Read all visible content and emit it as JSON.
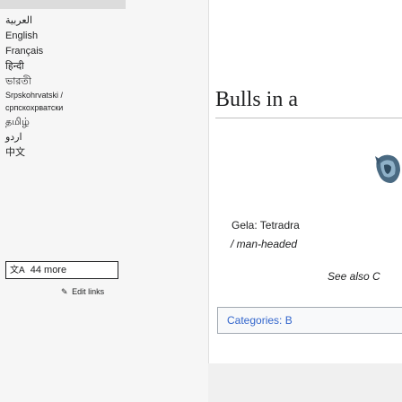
{
  "sidebar": {
    "languages": [
      {
        "label": "العربية",
        "small": false
      },
      {
        "label": "English",
        "small": false
      },
      {
        "label": "Français",
        "small": false
      },
      {
        "label": "हिन्दी",
        "small": false
      },
      {
        "label": "ভারতী",
        "small": false
      },
      {
        "label": "Srpskohrvatski /",
        "small": true
      },
      {
        "label": "српскохрватски",
        "small": true
      },
      {
        "label": "தமிழ்",
        "small": false
      },
      {
        "label": "اردو",
        "small": false
      },
      {
        "label": "中文",
        "small": false
      }
    ],
    "more_label": "44 more",
    "more_icon": "文A",
    "edit_links_label": "Edit links"
  },
  "content": {
    "title": "Bulls in a",
    "description_line1": "Gela: Tetradra",
    "description_line2": "/ man-headed",
    "see_also": "See also C",
    "categories": "Categories: B"
  }
}
